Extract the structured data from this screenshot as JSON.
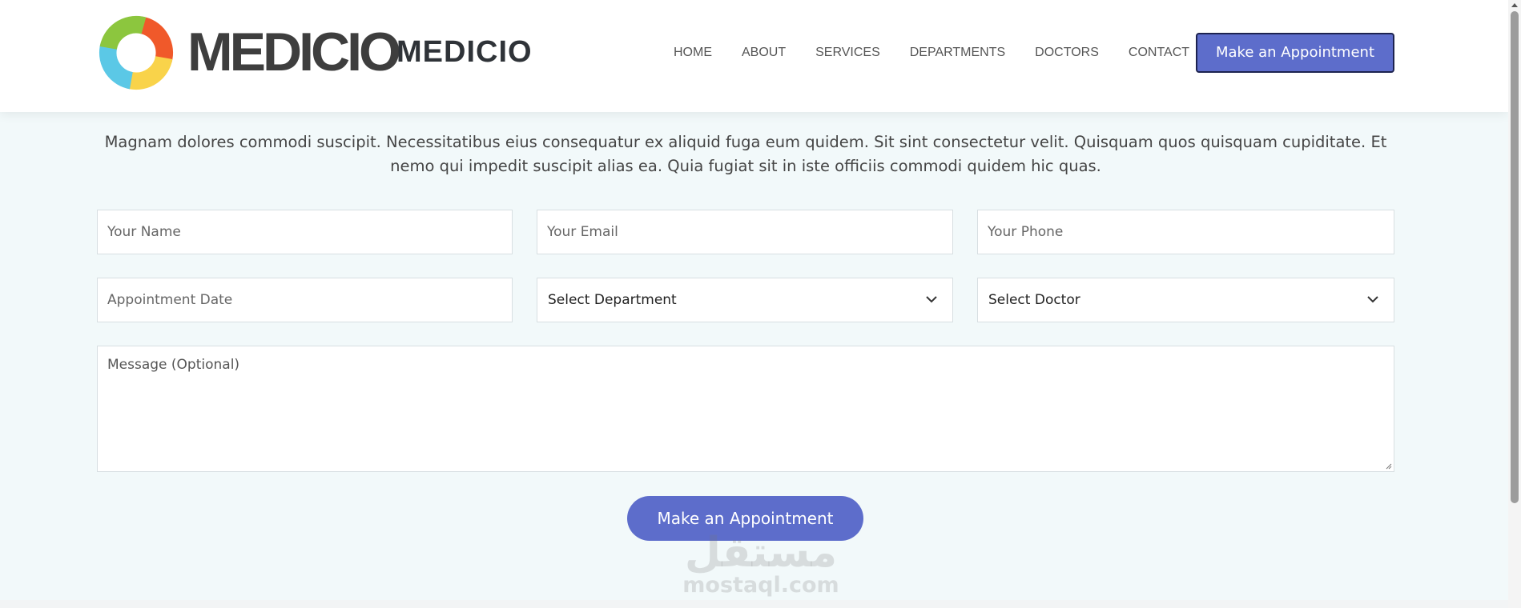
{
  "header": {
    "logo_text": "MEDICIO",
    "site_name": "MEDICIO",
    "nav": [
      {
        "label": "HOME"
      },
      {
        "label": "ABOUT"
      },
      {
        "label": "SERVICES"
      },
      {
        "label": "DEPARTMENTS"
      },
      {
        "label": "DOCTORS"
      },
      {
        "label": "CONTACT"
      }
    ],
    "cta_label": "Make an Appointment"
  },
  "intro_text": "Magnam dolores commodi suscipit. Necessitatibus eius consequatur ex aliquid fuga eum quidem. Sit sint consectetur velit. Quisquam quos quisquam cupiditate. Et nemo qui impedit suscipit alias ea. Quia fugiat sit in iste officiis commodi quidem hic quas.",
  "form": {
    "name_placeholder": "Your Name",
    "email_placeholder": "Your Email",
    "phone_placeholder": "Your Phone",
    "date_placeholder": "Appointment Date",
    "department_selected": "Select Department",
    "doctor_selected": "Select Doctor",
    "message_placeholder": "Message (Optional)",
    "submit_label": "Make an Appointment"
  },
  "watermark": {
    "arabic": "مستقل",
    "latin": "mostaql.com"
  },
  "colors": {
    "accent": "#5d6dcb",
    "page_background": "#f2f9fa"
  },
  "icons": [
    "logo-ring-icon",
    "chevron-down-icon",
    "resize-grip-icon",
    "scroll-up-arrow-icon"
  ]
}
